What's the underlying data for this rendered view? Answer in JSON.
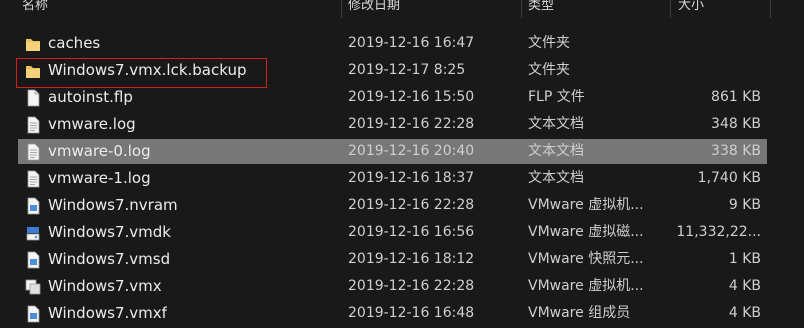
{
  "header": {
    "name": "名称",
    "date": "修改日期",
    "type": "类型",
    "size": "大小"
  },
  "rows": [
    {
      "icon": "folder-icon",
      "name": "caches",
      "date": "2019-12-16 16:47",
      "type": "文件夹",
      "size": ""
    },
    {
      "icon": "folder-icon",
      "name": "Windows7.vmx.lck.backup",
      "date": "2019-12-17 8:25",
      "type": "文件夹",
      "size": ""
    },
    {
      "icon": "file-icon",
      "name": "autoinst.flp",
      "date": "2019-12-16 15:50",
      "type": "FLP 文件",
      "size": "861 KB"
    },
    {
      "icon": "text-file-icon",
      "name": "vmware.log",
      "date": "2019-12-16 22:28",
      "type": "文本文档",
      "size": "348 KB"
    },
    {
      "icon": "text-file-icon",
      "name": "vmware-0.log",
      "date": "2019-12-16 20:40",
      "type": "文本文档",
      "size": "338 KB"
    },
    {
      "icon": "text-file-icon",
      "name": "vmware-1.log",
      "date": "2019-12-16 18:37",
      "type": "文本文档",
      "size": "1,740 KB"
    },
    {
      "icon": "vmware-file-icon",
      "name": "Windows7.nvram",
      "date": "2019-12-16 22:28",
      "type": "VMware 虚拟机...",
      "size": "9 KB"
    },
    {
      "icon": "vmware-disk-icon",
      "name": "Windows7.vmdk",
      "date": "2019-12-16 16:56",
      "type": "VMware 虚拟磁...",
      "size": "11,332,22..."
    },
    {
      "icon": "vmware-file-icon",
      "name": "Windows7.vmsd",
      "date": "2019-12-16 18:12",
      "type": "VMware 快照元...",
      "size": "1 KB"
    },
    {
      "icon": "vmware-vmx-icon",
      "name": "Windows7.vmx",
      "date": "2019-12-16 22:28",
      "type": "VMware 虚拟机...",
      "size": "4 KB"
    },
    {
      "icon": "vmware-file-icon",
      "name": "Windows7.vmxf",
      "date": "2019-12-16 16:48",
      "type": "VMware 组成员",
      "size": "4 KB"
    }
  ],
  "selected_row": "vmware-0.log",
  "outlined_row": "Windows7.vmx.lck.backup",
  "colors": {
    "background": "#191919",
    "selection": "#777777",
    "outline": "#d02020",
    "folder": "#e8c35a"
  }
}
